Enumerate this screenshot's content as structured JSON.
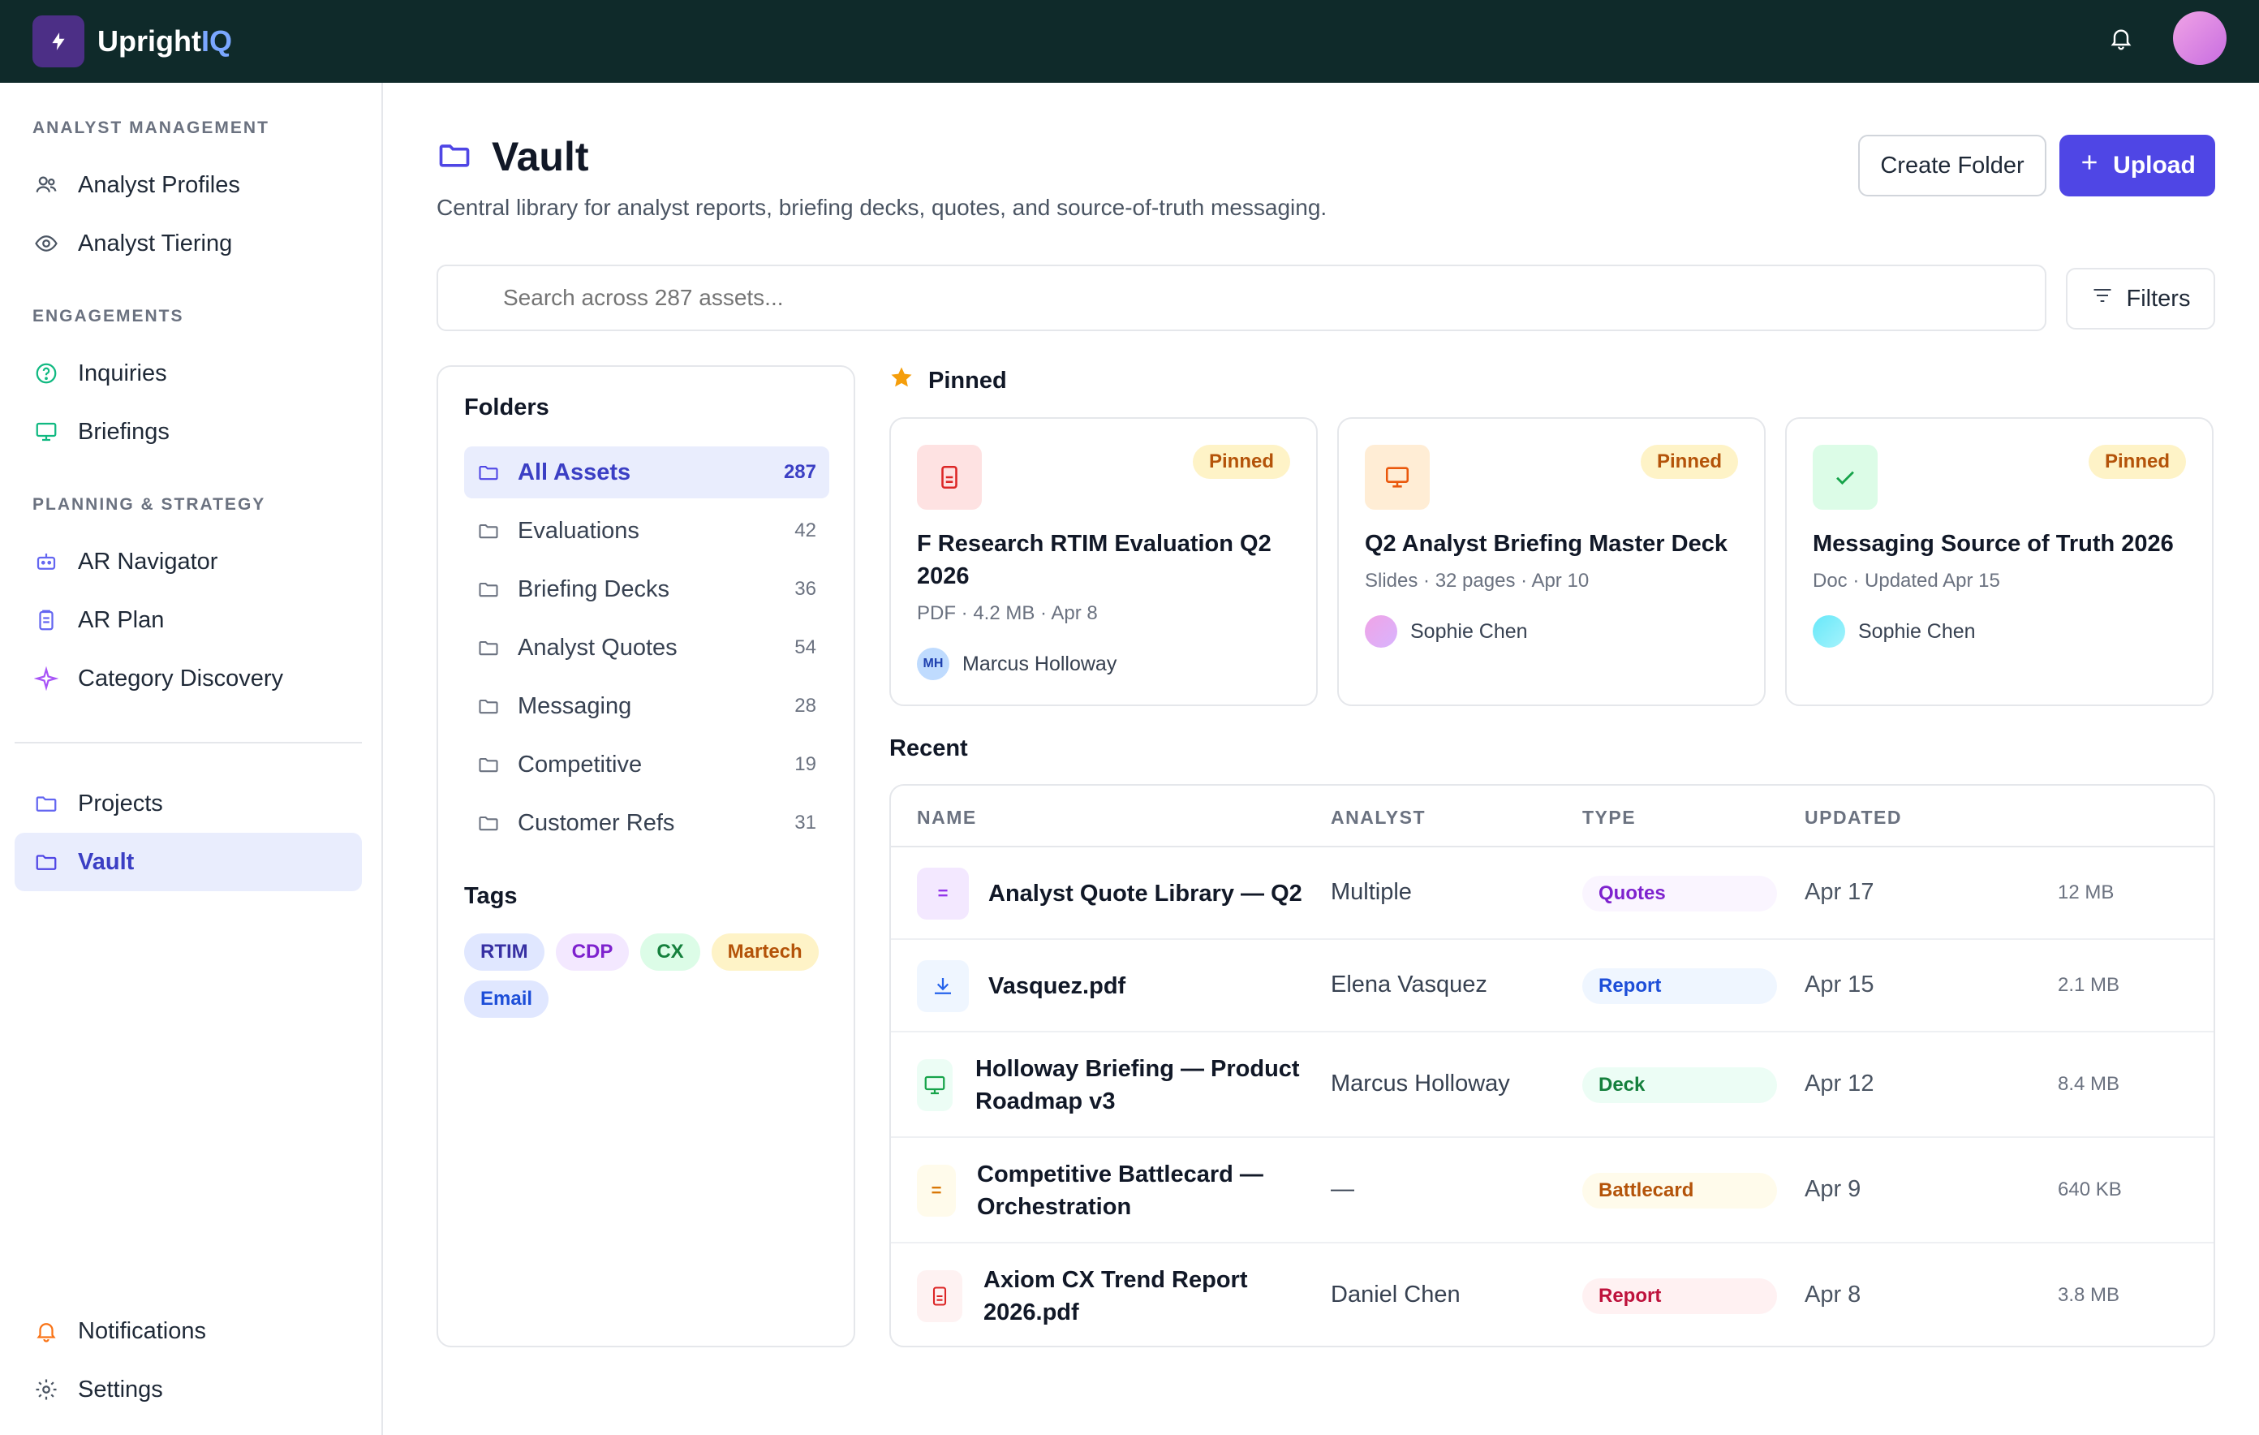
{
  "app": {
    "name_part1": "Upright",
    "name_part2": "IQ",
    "brand_color": "#4c2f86",
    "topbar_color": "#0f2a2a"
  },
  "sidebar": {
    "sections": [
      {
        "title": "ANALYST MANAGEMENT",
        "items": [
          {
            "label": "Analyst Profiles",
            "icon": "users-icon"
          },
          {
            "label": "Analyst Tiering",
            "icon": "eye-icon"
          }
        ]
      },
      {
        "title": "ENGAGEMENTS",
        "items": [
          {
            "label": "Inquiries",
            "icon": "question-icon"
          },
          {
            "label": "Briefings",
            "icon": "monitor-icon"
          }
        ]
      },
      {
        "title": "PLANNING & STRATEGY",
        "items": [
          {
            "label": "AR Navigator",
            "icon": "robot-icon"
          },
          {
            "label": "AR Plan",
            "icon": "clipboard-icon"
          },
          {
            "label": "Category Discovery",
            "icon": "sparkle-icon"
          }
        ]
      }
    ],
    "projects": {
      "label": "Projects",
      "icon": "folder-icon"
    },
    "vault": {
      "label": "Vault",
      "icon": "folder-icon",
      "active": true
    },
    "notifications": {
      "label": "Notifications",
      "icon": "bell-icon"
    },
    "settings": {
      "label": "Settings",
      "icon": "gear-icon"
    }
  },
  "header": {
    "title": "Vault",
    "subtitle": "Central library for analyst reports, briefing decks, quotes, and source-of-truth messaging.",
    "create_folder_label": "Create Folder",
    "upload_label": "Upload",
    "accent_color": "#4f46e5"
  },
  "search": {
    "placeholder": "Search across 287 assets...",
    "filters_label": "Filters"
  },
  "folders": {
    "title": "Folders",
    "items": [
      {
        "label": "All Assets",
        "count": "287",
        "active": true
      },
      {
        "label": "Evaluations",
        "count": "42"
      },
      {
        "label": "Briefing Decks",
        "count": "36"
      },
      {
        "label": "Analyst Quotes",
        "count": "54"
      },
      {
        "label": "Messaging",
        "count": "28"
      },
      {
        "label": "Competitive",
        "count": "19"
      },
      {
        "label": "Customer Refs",
        "count": "31"
      }
    ],
    "tags_title": "Tags",
    "tags": [
      "RTIM",
      "CDP",
      "CX",
      "Martech",
      "Email"
    ]
  },
  "pinned": {
    "title": "Pinned",
    "cards": [
      {
        "badge": "Pinned",
        "title": "F Research RTIM Evaluation Q2 2026",
        "meta": "PDF · 4.2 MB · Apr 8",
        "owner": "Marcus Holloway",
        "owner_initials": "MH",
        "icon": "document-icon"
      },
      {
        "badge": "Pinned",
        "title": "Q2 Analyst Briefing Master Deck",
        "meta": "Slides · 32 pages · Apr 10",
        "owner": "Sophie Chen",
        "icon": "presentation-icon"
      },
      {
        "badge": "Pinned",
        "title": "Messaging Source of Truth 2026",
        "meta": "Doc · Updated Apr 15",
        "owner": "Sophie Chen",
        "icon": "check-icon"
      }
    ]
  },
  "recent": {
    "title": "Recent",
    "columns": [
      "NAME",
      "ANALYST",
      "TYPE",
      "UPDATED"
    ],
    "rows": [
      {
        "name": "Analyst Quote Library — Q2",
        "analyst": "Multiple",
        "type": "Quotes",
        "updated": "Apr 17",
        "size": "12 MB",
        "icon_glyph": "="
      },
      {
        "name": "Vasquez.pdf",
        "analyst": "Elena Vasquez",
        "type": "Report",
        "updated": "Apr 15",
        "size": "2.1 MB"
      },
      {
        "name_line1": "Holloway Briefing — Product",
        "name_line2": "Roadmap v3",
        "analyst": "Marcus Holloway",
        "type": "Deck",
        "updated": "Apr 12",
        "size": "8.4 MB"
      },
      {
        "name_line1": "Competitive Battlecard —",
        "name_line2": "Orchestration",
        "analyst": "—",
        "type": "Battlecard",
        "updated": "Apr 9",
        "size": "640 KB",
        "icon_glyph": "="
      },
      {
        "name_line1": "Axiom CX Trend Report",
        "name_line2": "2026.pdf",
        "analyst": "Daniel Chen",
        "type": "Report",
        "updated": "Apr 8",
        "size": "3.8 MB"
      }
    ]
  }
}
